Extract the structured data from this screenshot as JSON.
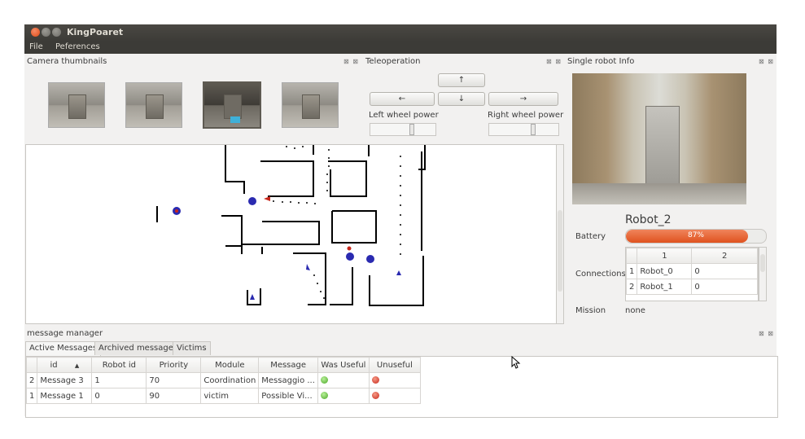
{
  "window": {
    "title": "KingPoaret"
  },
  "menu": {
    "items": [
      "File",
      "Peferences"
    ]
  },
  "panels": {
    "camera": {
      "title": "Camera thumbnails",
      "selected_index": 2,
      "count": 4
    },
    "teleop": {
      "title": "Teleoperation",
      "up_arrow": "↑",
      "down_arrow": "↓",
      "left_arrow": "←",
      "right_arrow": "→",
      "left_label": "Left wheel power",
      "right_label": "Right wheel power",
      "left_power": 0.65,
      "right_power": 0.65
    },
    "robot_info": {
      "title": "Single robot Info",
      "robot_name": "Robot_2",
      "battery_label": "Battery",
      "battery_text": "87%",
      "battery_value": 87,
      "connections_label": "Connections",
      "connections_headers": [
        "1",
        "2"
      ],
      "connections_rows": [
        {
          "num": "1",
          "robot": "Robot_0",
          "value": "0"
        },
        {
          "num": "2",
          "robot": "Robot_1",
          "value": "0"
        }
      ],
      "mission_label": "Mission",
      "mission_value": "none"
    },
    "messages": {
      "title": "message manager",
      "tabs": [
        "Active Messages",
        "Archived messages",
        "Victims"
      ],
      "active_tab": 0,
      "headers": [
        "id",
        "Robot id",
        "Priority",
        "Module",
        "Message",
        "Was Useful",
        "Unuseful"
      ],
      "sort_indicator": "▲",
      "rows": [
        {
          "num": "2",
          "id": "Message 3",
          "robot_id": "1",
          "priority": "70",
          "module": "Coordination",
          "message": "Messaggio ..."
        },
        {
          "num": "1",
          "id": "Message 1",
          "robot_id": "0",
          "priority": "90",
          "module": "victim",
          "message": "Possible Vi..."
        }
      ]
    }
  },
  "dock_buttons": "⊠ ⊠",
  "colors": {
    "battery": "#e0521e",
    "useful": "#4aa625",
    "unuseful": "#c8261a",
    "robot_marker": "#2a2ab0",
    "victim_marker": "#c8261a"
  }
}
